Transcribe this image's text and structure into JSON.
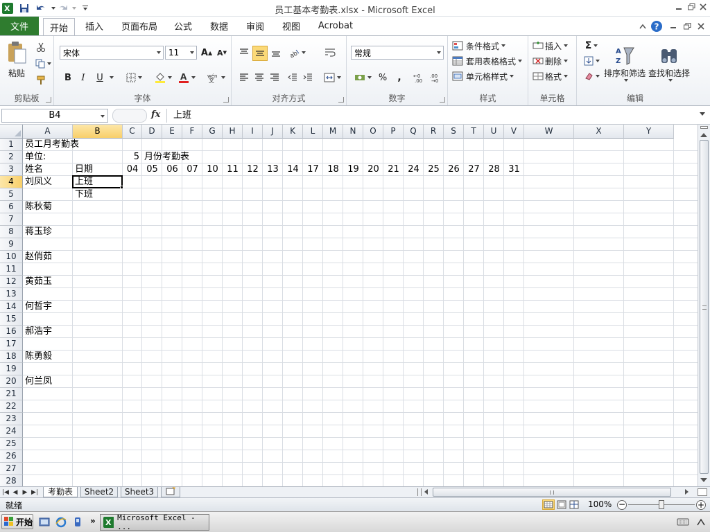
{
  "window": {
    "title": "员工基本考勤表.xlsx - Microsoft Excel"
  },
  "tabs": {
    "file": "文件",
    "items": [
      "开始",
      "插入",
      "页面布局",
      "公式",
      "数据",
      "审阅",
      "视图",
      "Acrobat"
    ]
  },
  "ribbon": {
    "clipboard": {
      "label": "剪贴板",
      "paste": "粘贴"
    },
    "font": {
      "label": "字体",
      "name": "宋体",
      "size": "11",
      "bold": "B",
      "italic": "I",
      "underline": "U"
    },
    "alignment": {
      "label": "对齐方式"
    },
    "number": {
      "label": "数字",
      "format": "常规",
      "percent": "%",
      "comma": ","
    },
    "styles": {
      "label": "样式",
      "conditional": "条件格式",
      "table": "套用表格格式",
      "cell": "单元格样式"
    },
    "cells": {
      "label": "单元格",
      "insert": "插入",
      "delete": "删除",
      "format": "格式"
    },
    "editing": {
      "label": "编辑",
      "sort": "排序和筛选",
      "find": "查找和选择"
    }
  },
  "formula_bar": {
    "name_box": "B4",
    "fx": "fx",
    "content": "上班"
  },
  "grid": {
    "selected_cell": "B4",
    "columns": [
      "A",
      "B",
      "C",
      "D",
      "E",
      "F",
      "G",
      "H",
      "I",
      "J",
      "K",
      "L",
      "M",
      "N",
      "O",
      "P",
      "Q",
      "R",
      "S",
      "T",
      "U",
      "V",
      "W",
      "X",
      "Y"
    ],
    "rows": [
      "1",
      "2",
      "3",
      "4",
      "5",
      "6",
      "7",
      "8",
      "9",
      "10",
      "11",
      "12",
      "13",
      "14",
      "15",
      "16",
      "17",
      "18",
      "19",
      "20",
      "21",
      "22",
      "23",
      "24",
      "25",
      "26",
      "27",
      "28"
    ],
    "cells": {
      "A1": "员工月考勤表",
      "A2": "单位:",
      "C2": "5",
      "D2": "月份考勤表",
      "A3": "姓名",
      "B3": "日期",
      "A4": "刘凤义",
      "B4": "上班",
      "B5": "下班",
      "A6": "陈秋菊",
      "A8": "蒋玉珍",
      "A10": "赵俏茹",
      "A12": "黄茹玉",
      "A14": "何哲宇",
      "A16": "郝浩宇",
      "A18": "陈勇毅",
      "A20": "何兰凤"
    },
    "row3_dates": [
      "04",
      "05",
      "06",
      "07",
      "10",
      "11",
      "12",
      "13",
      "14",
      "17",
      "18",
      "19",
      "20",
      "21",
      "24",
      "25",
      "26",
      "27",
      "28",
      "31"
    ]
  },
  "sheets": [
    "考勤表",
    "Sheet2",
    "Sheet3"
  ],
  "active_sheet": "考勤表",
  "status": {
    "ready": "就绪",
    "zoom": "100%"
  },
  "taskbar": {
    "start": "开始",
    "task": "Microsoft Excel - ..."
  },
  "colors": {
    "file_tab": "#2f7c2f",
    "selection_header": "#f8cf6a"
  }
}
